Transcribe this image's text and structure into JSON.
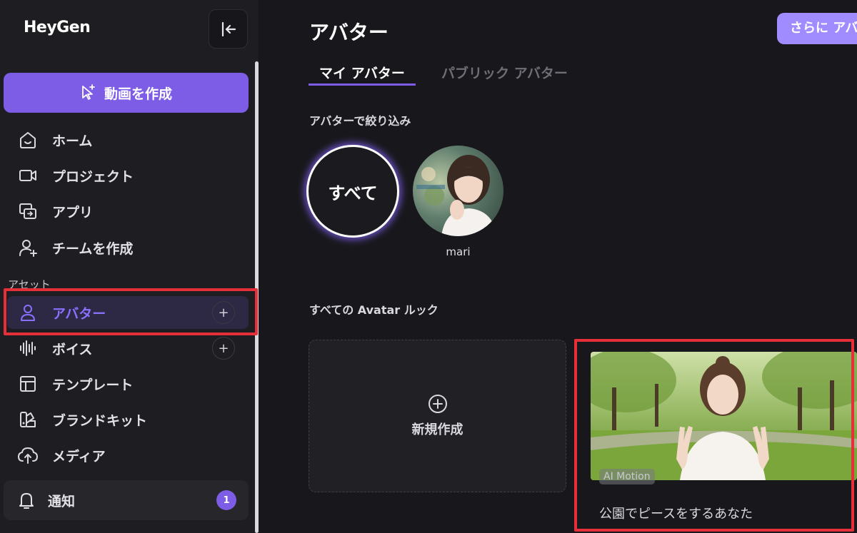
{
  "app": {
    "logo_text": "HeyGen"
  },
  "sidebar": {
    "create_button_label": "動画を作成",
    "items": [
      {
        "label": "ホーム",
        "icon": "home-icon"
      },
      {
        "label": "プロジェクト",
        "icon": "video-camera-icon"
      },
      {
        "label": "アプリ",
        "icon": "apps-icon"
      },
      {
        "label": "チームを作成",
        "icon": "add-user-icon"
      }
    ],
    "section_label": "アセット",
    "asset_items": [
      {
        "label": "アバター",
        "icon": "person-icon",
        "active": true,
        "has_add": true
      },
      {
        "label": "ボイス",
        "icon": "waveform-icon",
        "has_add": true
      },
      {
        "label": "テンプレート",
        "icon": "template-icon"
      },
      {
        "label": "ブランドキット",
        "icon": "brand-kit-icon"
      },
      {
        "label": "メディア",
        "icon": "cloud-upload-icon"
      }
    ],
    "notification": {
      "label": "通知",
      "count": "1",
      "icon": "bell-icon"
    },
    "add_symbol": "+"
  },
  "header": {
    "title": "アバター",
    "upgrade_label": "さらに アバ"
  },
  "tabs": [
    {
      "label": "マイ アバター",
      "active": true
    },
    {
      "label": "パブリック アバター",
      "active": false
    }
  ],
  "filter": {
    "label": "アバターで絞り込み",
    "all_label": "すべて",
    "avatars": [
      {
        "name": "mari"
      }
    ]
  },
  "looks": {
    "label": "すべての Avatar ルック",
    "new_label": "新規作成",
    "cards": [
      {
        "badge": "AI Motion",
        "name": "公園でピースをするあなた"
      }
    ]
  },
  "colors": {
    "accent": "#7d5ce6",
    "highlight_box": "#e5303a"
  }
}
